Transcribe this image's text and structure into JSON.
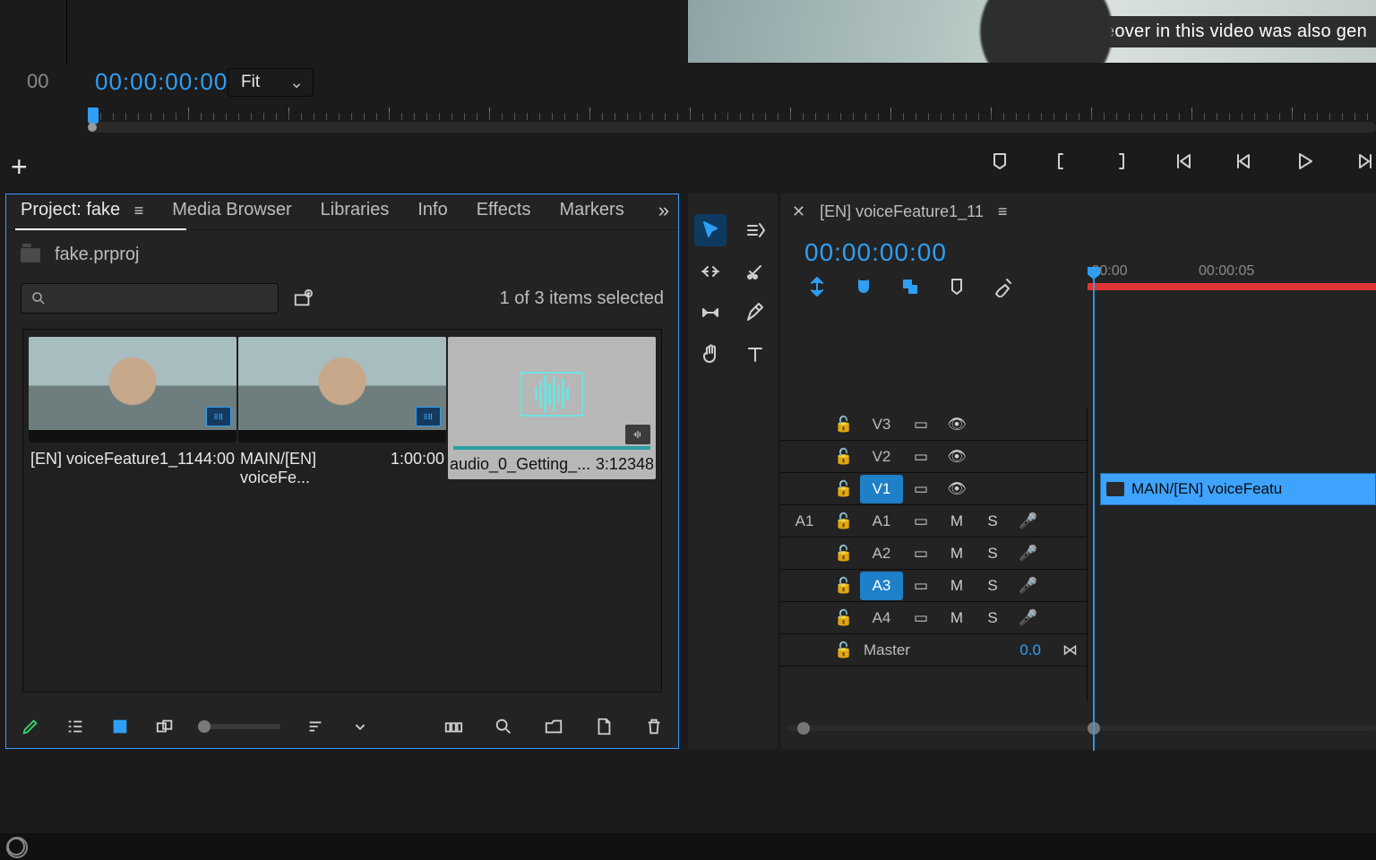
{
  "monitor": {
    "ruler_start": "00",
    "timecode": "00:00:00:00",
    "zoom_label": "Fit",
    "caption": "The voiceover in this video was also gen"
  },
  "project": {
    "tabs": [
      "Project: fake",
      "Media Browser",
      "Libraries",
      "Info",
      "Effects",
      "Markers"
    ],
    "active_tab": 0,
    "file_name": "fake.prproj",
    "selection_status": "1 of 3 items selected",
    "items": [
      {
        "name": "[EN] voiceFeature1_11",
        "duration": "44:00",
        "type": "sequence"
      },
      {
        "name": "MAIN/[EN] voiceFe...",
        "duration": "1:00:00",
        "type": "sequence"
      },
      {
        "name": "audio_0_Getting_...",
        "duration": "3:12348",
        "type": "audio",
        "selected": true
      }
    ]
  },
  "timeline": {
    "sequence_name": "[EN] voiceFeature1_11",
    "timecode": "00:00:00:00",
    "ruler_labels": [
      ":00:00",
      "00:00:05"
    ],
    "video_tracks": [
      {
        "name": "V3",
        "selected": false
      },
      {
        "name": "V2",
        "selected": false
      },
      {
        "name": "V1",
        "selected": true
      }
    ],
    "audio_tracks": [
      {
        "src": "A1",
        "name": "A1",
        "selected": false
      },
      {
        "src": "",
        "name": "A2",
        "selected": false
      },
      {
        "src": "",
        "name": "A3",
        "selected": true
      },
      {
        "src": "",
        "name": "A4",
        "selected": false
      }
    ],
    "master_label": "Master",
    "master_value": "0.0",
    "clip_label": "MAIN/[EN] voiceFeatu"
  },
  "icons": {
    "mute": "M",
    "solo": "S"
  }
}
